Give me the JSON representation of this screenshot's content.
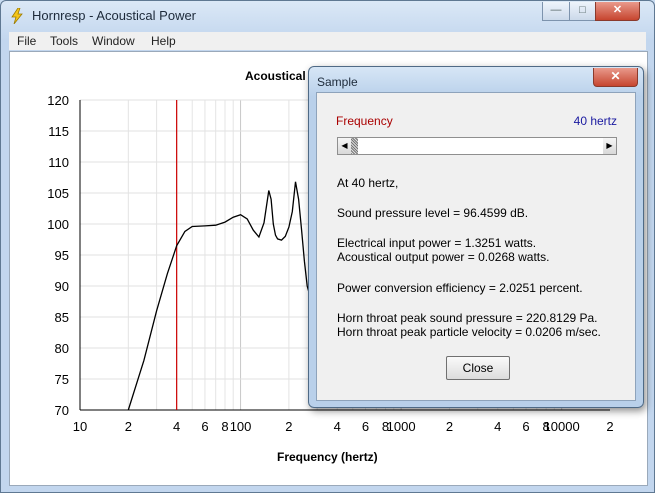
{
  "app": {
    "title": "Hornresp - Acoustical Power",
    "minimize_glyph": "—",
    "maximize_glyph": "□",
    "close_glyph": "✕"
  },
  "menu": [
    "File",
    "Tools",
    "Window",
    "Help"
  ],
  "chart_data": {
    "type": "line",
    "title": "Acoustical",
    "xlabel": "Frequency (hertz)",
    "ylabel": "",
    "xscale": "log",
    "xlim": [
      10,
      20000
    ],
    "ylim": [
      70,
      120
    ],
    "yticks": [
      70,
      75,
      80,
      85,
      90,
      95,
      100,
      105,
      110,
      115,
      120
    ],
    "xtick_labels": [
      {
        "x": 10,
        "label": "10"
      },
      {
        "x": 20,
        "label": "2"
      },
      {
        "x": 40,
        "label": "4"
      },
      {
        "x": 60,
        "label": "6"
      },
      {
        "x": 80,
        "label": "8"
      },
      {
        "x": 100,
        "label": "100"
      },
      {
        "x": 200,
        "label": "2"
      },
      {
        "x": 400,
        "label": "4"
      },
      {
        "x": 600,
        "label": "6"
      },
      {
        "x": 800,
        "label": "8"
      },
      {
        "x": 1000,
        "label": "1000"
      },
      {
        "x": 2000,
        "label": "2"
      },
      {
        "x": 4000,
        "label": "4"
      },
      {
        "x": 6000,
        "label": "6"
      },
      {
        "x": 8000,
        "label": "8"
      },
      {
        "x": 10000,
        "label": "10000"
      },
      {
        "x": 20000,
        "label": "2"
      }
    ],
    "marker_frequency": 40,
    "series": [
      {
        "color": "#000000",
        "x": [
          20,
          25,
          30,
          35,
          40,
          45,
          50,
          60,
          70,
          80,
          90,
          100,
          110,
          120,
          130,
          140,
          150,
          155,
          160,
          165,
          170,
          180,
          190,
          200,
          210,
          220,
          230,
          240,
          250,
          260,
          270
        ],
        "y": [
          70,
          78,
          86,
          92,
          96.5,
          98.8,
          99.6,
          99.7,
          99.8,
          100.3,
          101.1,
          101.5,
          100.8,
          99.0,
          97.9,
          100.2,
          105.4,
          104.0,
          100.0,
          98.2,
          97.6,
          97.4,
          98.0,
          99.5,
          102.0,
          106.8,
          104.0,
          99.0,
          94.0,
          90.0,
          88.5
        ]
      }
    ]
  },
  "dialog": {
    "title": "Sample",
    "close_glyph": "✕",
    "frequency_label": "Frequency",
    "frequency_value": "40 hertz",
    "slider_position": 0.0,
    "lines": [
      "At 40 hertz,",
      "Sound pressure level = 96.4599 dB.",
      "Electrical input power = 1.3251 watts.",
      "Acoustical output power = 0.0268 watts.",
      "Power conversion efficiency = 2.0251 percent.",
      "Horn throat peak sound pressure = 220.8129 Pa.",
      "Horn throat peak particle velocity = 0.0206 m/sec."
    ],
    "close_button": "Close"
  }
}
